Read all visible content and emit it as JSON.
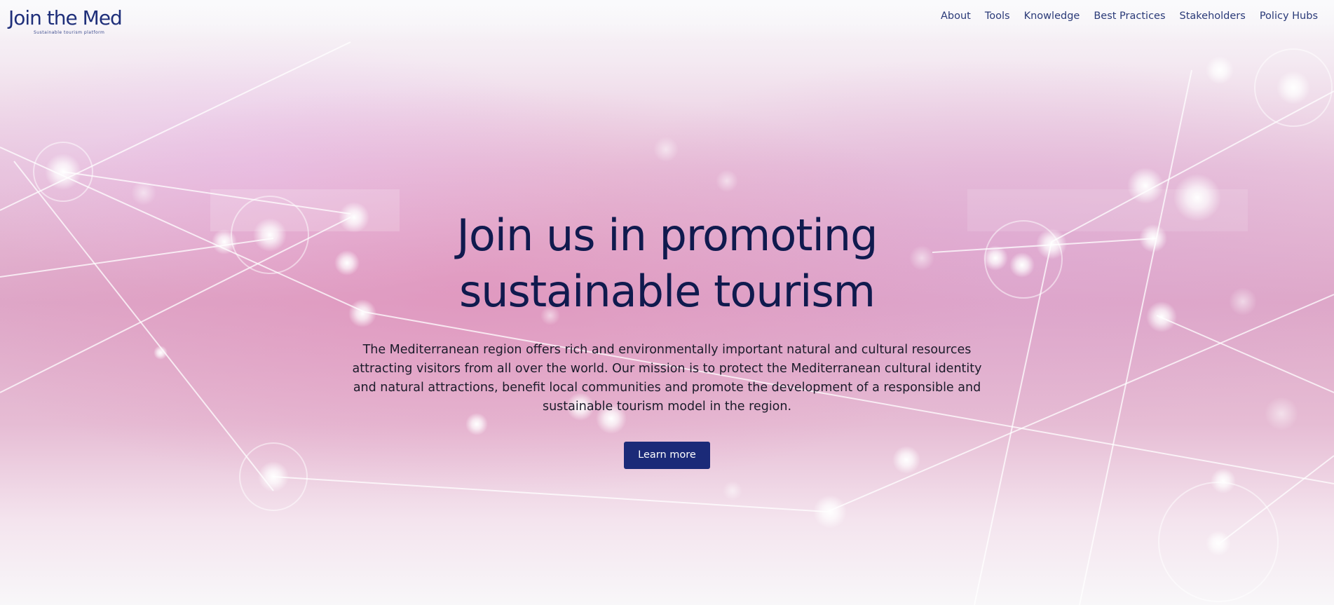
{
  "header": {
    "logo_text": "Join the Med",
    "logo_tagline": "Sustainable tourism platform"
  },
  "nav": {
    "items": [
      {
        "label": "About"
      },
      {
        "label": "Tools"
      },
      {
        "label": "Knowledge"
      },
      {
        "label": "Best Practices"
      },
      {
        "label": "Stakeholders"
      },
      {
        "label": "Policy Hubs"
      }
    ]
  },
  "hero": {
    "title": "Join us in promoting sustainable tourism",
    "description": "The Mediterranean region offers rich and environmentally important natural and cultural resources attracting visitors from all over the world. Our mission is to protect the Mediterranean cultural identity and natural attractions, benefit local communities and promote the development of a responsible and sustainable tourism model in the region.",
    "cta_label": "Learn more"
  },
  "colors": {
    "brand_navy": "#1b2a78",
    "title_navy": "#101a4e",
    "nav_text": "#2a3a78"
  }
}
